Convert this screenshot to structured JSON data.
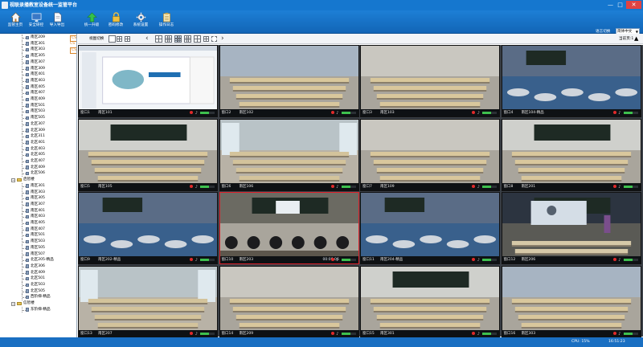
{
  "window": {
    "title": "视联录播教室设备统一监管平台",
    "controls": [
      "—",
      "□",
      "✕"
    ]
  },
  "toolbar": {
    "items": [
      {
        "label": "监管主页",
        "icon": "home-icon"
      },
      {
        "label": "安全研控",
        "icon": "monitor-icon"
      },
      {
        "label": "导入导出",
        "icon": "document-icon"
      },
      {
        "label": "统一升级",
        "icon": "upload-arrow-icon"
      },
      {
        "label": "密码修改",
        "icon": "lock-icon"
      },
      {
        "label": "系统设置",
        "icon": "gear-icon"
      },
      {
        "label": "操作日志",
        "icon": "clipboard-icon"
      }
    ],
    "language_label": "语言切换",
    "language_value": "简体中文"
  },
  "sidebar": {
    "rows": [
      {
        "label": "南区209",
        "type": "cam",
        "badge": "CS",
        "badge_box": true
      },
      {
        "label": "南区301",
        "type": "cam",
        "badge": "CS"
      },
      {
        "label": "南区303",
        "type": "cam",
        "badge": "CS",
        "badge_box": true
      },
      {
        "label": "南区305",
        "type": "cam"
      },
      {
        "label": "南区307",
        "type": "cam"
      },
      {
        "label": "南区309",
        "type": "cam"
      },
      {
        "label": "南区401",
        "type": "cam"
      },
      {
        "label": "南区403",
        "type": "cam"
      },
      {
        "label": "南区405",
        "type": "cam"
      },
      {
        "label": "南区407",
        "type": "cam"
      },
      {
        "label": "南区409",
        "type": "cam"
      },
      {
        "label": "南区501",
        "type": "cam"
      },
      {
        "label": "南区503",
        "type": "cam"
      },
      {
        "label": "南区505",
        "type": "cam"
      },
      {
        "label": "北区307",
        "type": "cam"
      },
      {
        "label": "北区309",
        "type": "cam"
      },
      {
        "label": "北区311",
        "type": "cam"
      },
      {
        "label": "北区401",
        "type": "cam"
      },
      {
        "label": "北区403",
        "type": "cam"
      },
      {
        "label": "北区405",
        "type": "cam"
      },
      {
        "label": "北区407",
        "type": "cam"
      },
      {
        "label": "北区409",
        "type": "cam"
      },
      {
        "label": "北区506",
        "type": "cam"
      },
      {
        "label": "启智楼",
        "type": "group",
        "expander": "−"
      },
      {
        "label": "南区301",
        "type": "cam"
      },
      {
        "label": "南区303",
        "type": "cam"
      },
      {
        "label": "南区305",
        "type": "cam"
      },
      {
        "label": "南区307",
        "type": "cam"
      },
      {
        "label": "南区401",
        "type": "cam"
      },
      {
        "label": "南区403",
        "type": "cam"
      },
      {
        "label": "南区405",
        "type": "cam"
      },
      {
        "label": "南区407",
        "type": "cam"
      },
      {
        "label": "南区501",
        "type": "cam"
      },
      {
        "label": "南区503",
        "type": "cam"
      },
      {
        "label": "南区505",
        "type": "cam"
      },
      {
        "label": "南区507",
        "type": "cam"
      },
      {
        "label": "北区205-精品",
        "type": "cam"
      },
      {
        "label": "北区306",
        "type": "cam"
      },
      {
        "label": "北区409",
        "type": "cam"
      },
      {
        "label": "北区501",
        "type": "cam"
      },
      {
        "label": "北区503",
        "type": "cam"
      },
      {
        "label": "北区505",
        "type": "cam"
      },
      {
        "label": "西阶梯-精品",
        "type": "cam"
      },
      {
        "label": "信智楼",
        "type": "group",
        "expander": "−"
      },
      {
        "label": "东阶梯-精品",
        "type": "cam"
      }
    ]
  },
  "viewbar": {
    "view_switch_label": "视图切换",
    "page_label": "当前页:",
    "page_value": "1"
  },
  "tiles": [
    {
      "win": "窗口1",
      "room": "南区101",
      "scene": "slides",
      "clock": ""
    },
    {
      "win": "窗口2",
      "room": "南区102",
      "scene": "class-blue",
      "clock": ""
    },
    {
      "win": "窗口3",
      "room": "南区103",
      "scene": "class-desks",
      "clock": ""
    },
    {
      "win": "窗口4",
      "room": "南区104-精品",
      "scene": "class-round",
      "clock": ""
    },
    {
      "win": "窗口5",
      "room": "南区105",
      "scene": "class-board",
      "clock": ""
    },
    {
      "win": "窗口6",
      "room": "南区106",
      "scene": "class-window",
      "clock": ""
    },
    {
      "win": "窗口7",
      "room": "南区109",
      "scene": "class-desks",
      "clock": ""
    },
    {
      "win": "窗口8",
      "room": "南区201",
      "scene": "class-board",
      "clock": ""
    },
    {
      "win": "窗口9",
      "room": "南区202-精品",
      "scene": "class-round",
      "clock": ""
    },
    {
      "win": "窗口10",
      "room": "南区203",
      "scene": "class-students",
      "clock": "00:06:06",
      "selected": true
    },
    {
      "win": "窗口11",
      "room": "南区204-精品",
      "scene": "class-round",
      "clock": ""
    },
    {
      "win": "窗口12",
      "room": "南区206",
      "scene": "class-teacher",
      "clock": ""
    },
    {
      "win": "窗口13",
      "room": "南区207",
      "scene": "class-window",
      "clock": ""
    },
    {
      "win": "窗口14",
      "room": "南区209",
      "scene": "class-desks",
      "clock": ""
    },
    {
      "win": "窗口15",
      "room": "南区301",
      "scene": "class-board",
      "clock": ""
    },
    {
      "win": "窗口16",
      "room": "南区303",
      "scene": "class-blue",
      "clock": ""
    }
  ],
  "status": {
    "cpu": "CPU: 15%",
    "time": "16:51:23"
  }
}
